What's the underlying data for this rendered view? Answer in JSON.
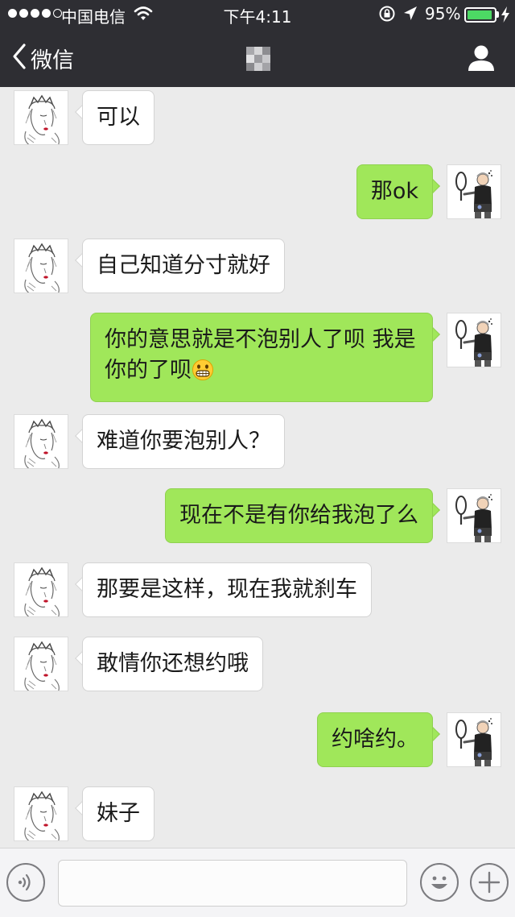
{
  "status_bar": {
    "carrier": "中国电信",
    "time": "下午4:11",
    "battery": "95%",
    "battery_level": 0.95
  },
  "nav": {
    "back_label": "微信"
  },
  "messages": [
    {
      "side": "left",
      "text": "可以"
    },
    {
      "side": "right",
      "text": "那ok"
    },
    {
      "side": "left",
      "text": "自己知道分寸就好"
    },
    {
      "side": "right",
      "text": "你的意思就是不泡别人了呗 我是你的了呗",
      "emoji": "grinning-face-emoji"
    },
    {
      "side": "left",
      "text": "难道你要泡别人？"
    },
    {
      "side": "right",
      "text": "现在不是有你给我泡了么"
    },
    {
      "side": "left",
      "text": "那要是这样，现在我就刹车"
    },
    {
      "side": "left",
      "text": "敢情你还想约哦"
    },
    {
      "side": "right",
      "text": "约啥约。"
    },
    {
      "side": "left",
      "text": "妹子"
    }
  ],
  "input": {
    "value": "",
    "placeholder": ""
  },
  "icons": {
    "back": "chevron-left-icon",
    "profile": "person-icon",
    "voice": "voice-icon",
    "emoji": "smiley-icon",
    "more": "plus-icon"
  },
  "colors": {
    "nav_background": "#2e2e33",
    "chat_background": "#ebebeb",
    "sent_bubble": "#a0e75a",
    "received_bubble": "#ffffff",
    "battery": "#4cd964"
  }
}
